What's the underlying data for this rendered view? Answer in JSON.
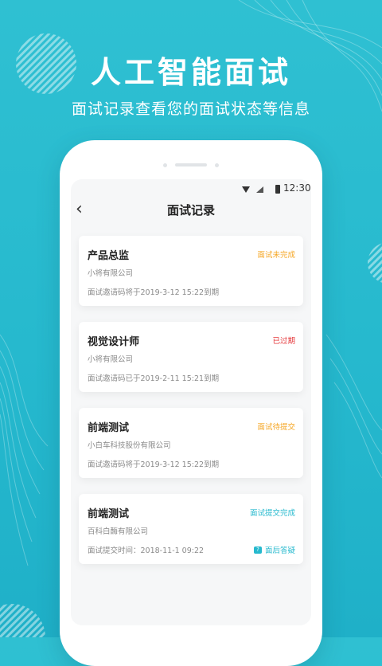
{
  "promo": {
    "title": "人工智能面试",
    "subtitle": "面试记录查看您的面试状态等信息"
  },
  "status_bar": {
    "time": "12:30"
  },
  "nav": {
    "back_icon": "chevron-left-icon",
    "title": "面试记录"
  },
  "cards": [
    {
      "title": "产品总监",
      "status": "面试未完成",
      "status_color": "#f5a623",
      "company": "小将有限公司",
      "note": "面试邀请码将于2019-3-12 15:22到期"
    },
    {
      "title": "视觉设计师",
      "status": "已过期",
      "status_color": "#e5383b",
      "company": "小将有限公司",
      "note": "面试邀请码已于2019-2-11 15:21到期"
    },
    {
      "title": "前端测试",
      "status": "面试待提交",
      "status_color": "#f5a623",
      "company": "小白车科技股份有限公司",
      "note": "面试邀请码将于2019-3-12 15:22到期"
    },
    {
      "title": "前端测试",
      "status": "面试提交完成",
      "status_color": "#26b9ce",
      "company": "百科白酶有限公司",
      "note": "面试提交时间：2018-11-1 09:22",
      "action": "面后答疑",
      "action_icon": "question-bubble-icon"
    }
  ],
  "colors": {
    "accent": "#26b9ce",
    "warning": "#f5a623",
    "danger": "#e5383b"
  }
}
